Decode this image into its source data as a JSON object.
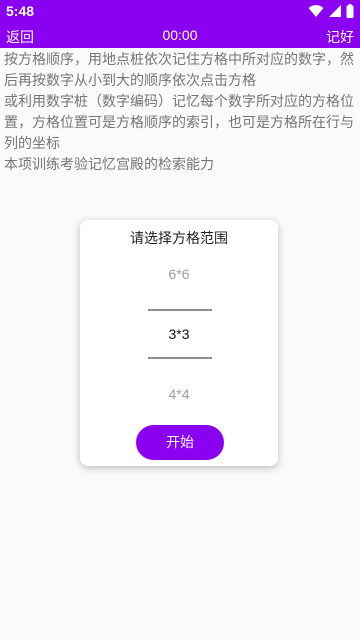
{
  "status_bar": {
    "time": "5:48"
  },
  "app_bar": {
    "back_label": "返回",
    "timer": "00:00",
    "remember_label": "记好"
  },
  "instructions": [
    "按方格顺序，用地点桩依次记住方格中所对应的数字，然后再按数字从小到大的顺序依次点击方格",
    "或利用数字桩（数字编码）记忆每个数字所对应的方格位置，方格位置可是方格顺序的索引，也可是方格所在行与列的坐标",
    "本项训练考验记忆宫殿的检索能力"
  ],
  "dialog": {
    "title": "请选择方格范围",
    "options": [
      "6*6",
      "3*3",
      "4*4"
    ],
    "selected": "3*3",
    "start_label": "开始"
  },
  "colors": {
    "accent": "#8a00f0"
  }
}
